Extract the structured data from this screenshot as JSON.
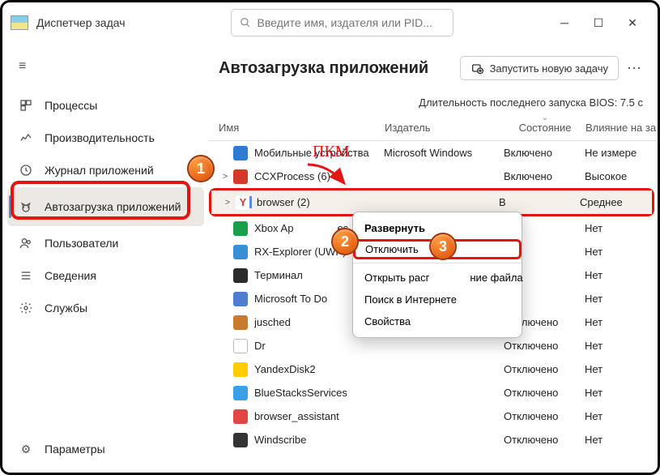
{
  "app": {
    "title": "Диспетчер задач"
  },
  "search": {
    "placeholder": "Введите имя, издателя или PID..."
  },
  "sidebar": {
    "items": [
      {
        "label": "Процессы"
      },
      {
        "label": "Производительность"
      },
      {
        "label": "Журнал приложений"
      },
      {
        "label": "Автозагрузка приложений"
      },
      {
        "label": "Пользователи"
      },
      {
        "label": "Сведения"
      },
      {
        "label": "Службы"
      }
    ],
    "settings": "Параметры"
  },
  "page": {
    "title": "Автозагрузка приложений",
    "run_task": "Запустить новую задачу",
    "bios": "Длительность последнего запуска BIOS: 7.5 с",
    "cols": {
      "name": "Имя",
      "publisher": "Издатель",
      "state": "Состояние",
      "impact": "Влияние на за"
    }
  },
  "rows": [
    {
      "exp": "",
      "name": "Мобильные устройства",
      "pub": "Microsoft Windows",
      "state": "Включено",
      "impact": "Не измере",
      "ico": "#2f7bd3"
    },
    {
      "exp": ">",
      "name": "CCXProcess (6)",
      "pub": "",
      "state": "Включено",
      "impact": "Высокое",
      "ico": "#d43a2a"
    },
    {
      "exp": ">",
      "name": "browser (2)",
      "pub": "",
      "state": "В",
      "impact": "Среднее",
      "ico": "#fff",
      "y": true
    },
    {
      "exp": "",
      "name": "Xbox Ap",
      "pub": "",
      "state": "",
      "impact": "Нет",
      "ico": "#1a9f4b",
      "suf": "es"
    },
    {
      "exp": "",
      "name": "RX-Explorer (UWP)",
      "pub": "",
      "state": "",
      "impact": "Нет",
      "ico": "#388fd6"
    },
    {
      "exp": "",
      "name": "Терминал",
      "pub": "",
      "state": "",
      "impact": "Нет",
      "ico": "#2b2b2b"
    },
    {
      "exp": "",
      "name": "Microsoft To Do",
      "pub": "",
      "state": "",
      "impact": "Нет",
      "ico": "#4f7dd1"
    },
    {
      "exp": "",
      "name": "jusched",
      "pub": "",
      "state": "Отключено",
      "impact": "Нет",
      "ico": "#c97a2c"
    },
    {
      "exp": "",
      "name": "Dr",
      "pub": "",
      "state": "Отключено",
      "impact": "Нет",
      "ico": "#fff",
      "b": true
    },
    {
      "exp": "",
      "name": "YandexDisk2",
      "pub": "",
      "state": "Отключено",
      "impact": "Нет",
      "ico": "#ffcc00"
    },
    {
      "exp": "",
      "name": "BlueStacksServices",
      "pub": "",
      "state": "Отключено",
      "impact": "Нет",
      "ico": "#3aa0e8"
    },
    {
      "exp": "",
      "name": "browser_assistant",
      "pub": "",
      "state": "Отключено",
      "impact": "Нет",
      "ico": "#e04848"
    },
    {
      "exp": "",
      "name": "Windscribe",
      "pub": "",
      "state": "Отключено",
      "impact": "Нет",
      "ico": "#333"
    }
  ],
  "context": {
    "items": [
      {
        "label": "Развернуть",
        "bold": true
      },
      {
        "label": "Отключить",
        "hl": true
      },
      {
        "sep": true
      },
      {
        "label": "Открыть расг",
        "suf": "ние файла"
      },
      {
        "label": "Поиск в Интернете"
      },
      {
        "label": "Свойства"
      }
    ]
  },
  "annotations": {
    "pkm": "ПКМ",
    "b1": "1",
    "b2": "2",
    "b3": "3"
  }
}
